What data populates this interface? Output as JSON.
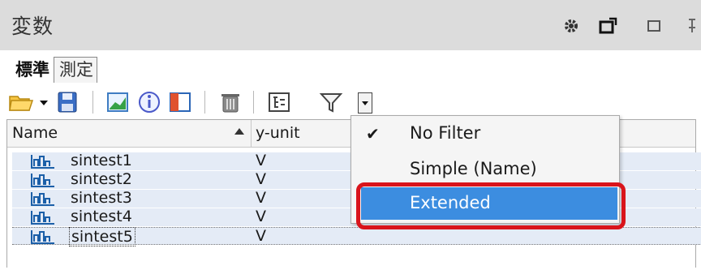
{
  "window": {
    "title": "変数",
    "buttons": [
      "settings-icon",
      "maximize-icon",
      "restore-icon",
      "pin-icon"
    ]
  },
  "tabs": [
    {
      "label": "標準",
      "active": true
    },
    {
      "label": "測定",
      "active": false
    }
  ],
  "toolbar": {
    "icons": [
      "folder-open-icon",
      "dropdown-arrow-icon",
      "save-icon",
      "chart-icon",
      "info-icon",
      "panel-icon",
      "delete-icon",
      "tree-icon",
      "filter-icon",
      "filter-dropdown-icon"
    ]
  },
  "table": {
    "columns": [
      "Name",
      "y-unit"
    ],
    "rows": [
      {
        "name": "sintest1",
        "unit": "V"
      },
      {
        "name": "sintest2",
        "unit": "V"
      },
      {
        "name": "sintest3",
        "unit": "V"
      },
      {
        "name": "sintest4",
        "unit": "V"
      },
      {
        "name": "sintest5",
        "unit": "V"
      }
    ]
  },
  "filter_menu": {
    "items": [
      {
        "label": "No Filter",
        "checked": true
      },
      {
        "label": "Simple (Name)",
        "checked": false
      },
      {
        "label": "Extended",
        "checked": false,
        "highlighted": true
      }
    ],
    "check_glyph": "✔"
  },
  "colors": {
    "highlight": "#3c8de0",
    "callout_border": "#d9141b",
    "selection": "#e4ebf6"
  }
}
